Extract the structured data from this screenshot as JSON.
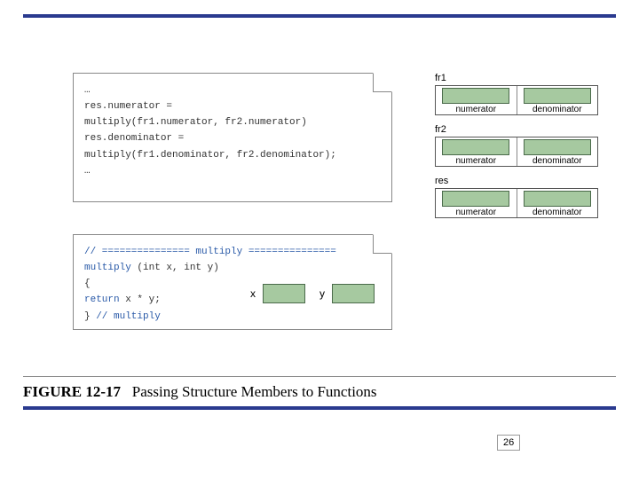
{
  "caption": {
    "fig": "FIGURE 12-17",
    "title": "Passing Structure Members to Functions"
  },
  "page_number": "26",
  "panel1": {
    "l1": "…",
    "l2": "res.numerator =",
    "l3": "    multiply(fr1.numerator, fr2.numerator)",
    "l4": "res.denominator =",
    "l5": "    multiply(fr1.denominator, fr2.denominator);",
    "l6": "…"
  },
  "panel2": {
    "l1a": "// =============== ",
    "l1b": "multiply",
    "l1c": " ===============",
    "l2a": "multiply",
    "l2b": " (int x, int y)",
    "l3": "{",
    "l4a": "   return",
    "l4b": " x * y;",
    "l5a": "} ",
    "l5b": " // multiply"
  },
  "structs": {
    "s1": {
      "label": "fr1",
      "f1": "numerator",
      "f2": "denominator"
    },
    "s2": {
      "label": "fr2",
      "f1": "numerator",
      "f2": "denominator"
    },
    "s3": {
      "label": "res",
      "f1": "numerator",
      "f2": "denominator"
    }
  },
  "xy": {
    "x": "x",
    "y": "y"
  }
}
